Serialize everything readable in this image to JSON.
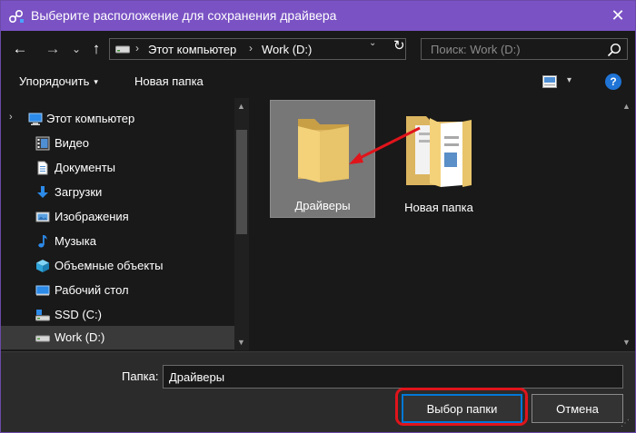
{
  "window": {
    "title": "Выберите расположение для сохранения драйвера",
    "accent_color": "#7a52c4",
    "close_glyph": "✕"
  },
  "nav": {
    "back_glyph": "←",
    "forward_glyph": "→",
    "recent_glyph": "⌄",
    "up_glyph": "↑",
    "address": {
      "drive_icon": "drive-icon",
      "separator": "›",
      "crumbs": [
        "Этот компьютер",
        "Work (D:)"
      ],
      "dropdown_glyph": "⌄"
    },
    "refresh_glyph": "↻",
    "search_placeholder": "Поиск: Work (D:)"
  },
  "toolbar": {
    "organize_label": "Упорядочить",
    "organize_caret": "▾",
    "new_folder_label": "Новая папка",
    "view_caret": "▾",
    "help_label": "?"
  },
  "sidebar": {
    "expander_glyph": "›",
    "items": [
      {
        "label": "Этот компьютер",
        "icon": "computer-icon",
        "level": 0
      },
      {
        "label": "Видео",
        "icon": "video-icon",
        "level": 1
      },
      {
        "label": "Документы",
        "icon": "documents-icon",
        "level": 1
      },
      {
        "label": "Загрузки",
        "icon": "downloads-icon",
        "level": 1
      },
      {
        "label": "Изображения",
        "icon": "pictures-icon",
        "level": 1
      },
      {
        "label": "Музыка",
        "icon": "music-icon",
        "level": 1
      },
      {
        "label": "Объемные объекты",
        "icon": "3d-objects-icon",
        "level": 1
      },
      {
        "label": "Рабочий стол",
        "icon": "desktop-icon",
        "level": 1
      },
      {
        "label": "SSD (C:)",
        "icon": "ssd-drive-icon",
        "level": 1
      },
      {
        "label": "Work (D:)",
        "icon": "work-drive-icon",
        "level": 1,
        "selected": true
      }
    ]
  },
  "content": {
    "folders": [
      {
        "name": "Драйверы",
        "selected": true
      },
      {
        "name": "Новая папка",
        "selected": false
      }
    ],
    "annotation_color": "#e0141b"
  },
  "footer": {
    "folder_label": "Папка:",
    "folder_value": "Драйверы",
    "select_button": "Выбор папки",
    "cancel_button": "Отмена"
  }
}
